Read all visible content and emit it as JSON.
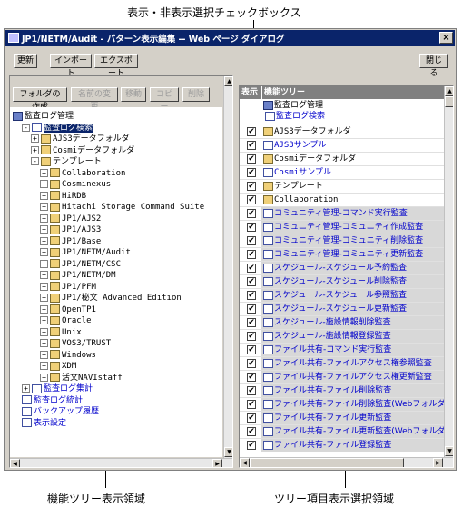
{
  "callouts": {
    "top": "表示・非表示選択チェックボックス",
    "left": "機能ツリー表示領域",
    "right": "ツリー項目表示選択領域"
  },
  "window": {
    "title": "JP1/NETM/Audit - パターン表示編集 -- Web ページ ダイアログ",
    "close_glyph": "×"
  },
  "toolbar": {
    "update": "更新",
    "import": "インポート",
    "export": "エクスポート",
    "close": "閉じる"
  },
  "left_toolbar": {
    "new_folder": "フォルダの作成",
    "rename": "名前の変更",
    "move": "移動",
    "copy": "コピー",
    "delete": "削除"
  },
  "tree": [
    {
      "label": "監査ログ管理",
      "indent": 0,
      "exp": "",
      "icon": "root"
    },
    {
      "label": "監査ログ検索",
      "indent": 1,
      "exp": "-",
      "icon": "doc",
      "selected": true
    },
    {
      "label": "AJS3データフォルダ",
      "indent": 2,
      "exp": "+",
      "icon": "folder"
    },
    {
      "label": "Cosmiデータフォルダ",
      "indent": 2,
      "exp": "+",
      "icon": "folder"
    },
    {
      "label": "テンプレート",
      "indent": 2,
      "exp": "-",
      "icon": "folder"
    },
    {
      "label": "Collaboration",
      "indent": 3,
      "exp": "+",
      "icon": "folder"
    },
    {
      "label": "Cosminexus",
      "indent": 3,
      "exp": "+",
      "icon": "folder"
    },
    {
      "label": "HiRDB",
      "indent": 3,
      "exp": "+",
      "icon": "folder"
    },
    {
      "label": "Hitachi Storage Command Suite",
      "indent": 3,
      "exp": "+",
      "icon": "folder"
    },
    {
      "label": "JP1/AJS2",
      "indent": 3,
      "exp": "+",
      "icon": "folder"
    },
    {
      "label": "JP1/AJS3",
      "indent": 3,
      "exp": "+",
      "icon": "folder"
    },
    {
      "label": "JP1/Base",
      "indent": 3,
      "exp": "+",
      "icon": "folder"
    },
    {
      "label": "JP1/NETM/Audit",
      "indent": 3,
      "exp": "+",
      "icon": "folder"
    },
    {
      "label": "JP1/NETM/CSC",
      "indent": 3,
      "exp": "+",
      "icon": "folder"
    },
    {
      "label": "JP1/NETM/DM",
      "indent": 3,
      "exp": "+",
      "icon": "folder"
    },
    {
      "label": "JP1/PFM",
      "indent": 3,
      "exp": "+",
      "icon": "folder"
    },
    {
      "label": "JP1/秘文 Advanced Edition",
      "indent": 3,
      "exp": "+",
      "icon": "folder"
    },
    {
      "label": "OpenTP1",
      "indent": 3,
      "exp": "+",
      "icon": "folder"
    },
    {
      "label": "Oracle",
      "indent": 3,
      "exp": "+",
      "icon": "folder"
    },
    {
      "label": "Unix",
      "indent": 3,
      "exp": "+",
      "icon": "folder"
    },
    {
      "label": "VOS3/TRUST",
      "indent": 3,
      "exp": "+",
      "icon": "folder"
    },
    {
      "label": "Windows",
      "indent": 3,
      "exp": "+",
      "icon": "folder"
    },
    {
      "label": "XDM",
      "indent": 3,
      "exp": "+",
      "icon": "folder"
    },
    {
      "label": "活文NAVIstaff",
      "indent": 3,
      "exp": "+",
      "icon": "folder"
    },
    {
      "label": "監査ログ集計",
      "indent": 1,
      "exp": "+",
      "icon": "doc",
      "link": true
    },
    {
      "label": "監査ログ統計",
      "indent": 1,
      "exp": "",
      "icon": "doc",
      "link": true
    },
    {
      "label": "バックアップ履歴",
      "indent": 1,
      "exp": "",
      "icon": "doc",
      "link": true
    },
    {
      "label": "表示設定",
      "indent": 1,
      "exp": "",
      "icon": "doc",
      "link": true
    }
  ],
  "right_header": {
    "show": "表示",
    "tree": "機能ツリー"
  },
  "checkbox_mark": "✔",
  "right_top_items": [
    {
      "label": "監査ログ管理",
      "icon": "root",
      "indent": 0
    },
    {
      "label": "監査ログ検索",
      "icon": "doc",
      "indent": 1,
      "link": true
    }
  ],
  "right_items": [
    {
      "label": "AJS3データフォルダ",
      "icon": "folder",
      "link": false,
      "mono": true
    },
    {
      "label": "AJS3サンプル",
      "icon": "doc",
      "link": true,
      "mono": true
    },
    {
      "label": "Cosmiデータフォルダ",
      "icon": "folder",
      "link": false,
      "mono": true
    },
    {
      "label": "Cosmiサンプル",
      "icon": "doc",
      "link": true,
      "mono": true
    },
    {
      "label": "テンプレート",
      "icon": "folder",
      "link": false
    },
    {
      "label": "Collaboration",
      "icon": "folder",
      "link": false,
      "mono": true
    },
    {
      "label": "コミュニティ管理-コマンド実行監査",
      "icon": "doc",
      "link": true,
      "shaded": true
    },
    {
      "label": "コミュニティ管理-コミュニティ作成監査",
      "icon": "doc",
      "link": true,
      "shaded": true
    },
    {
      "label": "コミュニティ管理-コミュニティ削除監査",
      "icon": "doc",
      "link": true,
      "shaded": true
    },
    {
      "label": "コミュニティ管理-コミュニティ更新監査",
      "icon": "doc",
      "link": true,
      "shaded": true
    },
    {
      "label": "スケジュール-スケジュール予約監査",
      "icon": "doc",
      "link": true,
      "shaded": true
    },
    {
      "label": "スケジュール-スケジュール削除監査",
      "icon": "doc",
      "link": true,
      "shaded": true
    },
    {
      "label": "スケジュール-スケジュール参照監査",
      "icon": "doc",
      "link": true,
      "shaded": true
    },
    {
      "label": "スケジュール-スケジュール更新監査",
      "icon": "doc",
      "link": true,
      "shaded": true
    },
    {
      "label": "スケジュール-施設情報削除監査",
      "icon": "doc",
      "link": true,
      "shaded": true
    },
    {
      "label": "スケジュール-施設情報登録監査",
      "icon": "doc",
      "link": true,
      "shaded": true
    },
    {
      "label": "ファイル共有-コマンド実行監査",
      "icon": "doc",
      "link": true,
      "shaded": true
    },
    {
      "label": "ファイル共有-ファイルアクセス権参照監査",
      "icon": "doc",
      "link": true,
      "shaded": true
    },
    {
      "label": "ファイル共有-ファイルアクセス権更新監査",
      "icon": "doc",
      "link": true,
      "shaded": true
    },
    {
      "label": "ファイル共有-ファイル削除監査",
      "icon": "doc",
      "link": true,
      "shaded": true
    },
    {
      "label": "ファイル共有-ファイル削除監査(Webフォルダ)",
      "icon": "doc",
      "link": true,
      "shaded": true
    },
    {
      "label": "ファイル共有-ファイル更新監査",
      "icon": "doc",
      "link": true,
      "shaded": true
    },
    {
      "label": "ファイル共有-ファイル更新監査(Webフォルダ)",
      "icon": "doc",
      "link": true,
      "shaded": true
    },
    {
      "label": "ファイル共有-ファイル登録監査",
      "icon": "doc",
      "link": true,
      "shaded": true
    }
  ],
  "scroll": {
    "up": "▲",
    "down": "▼",
    "left": "◀",
    "right": "▶"
  }
}
